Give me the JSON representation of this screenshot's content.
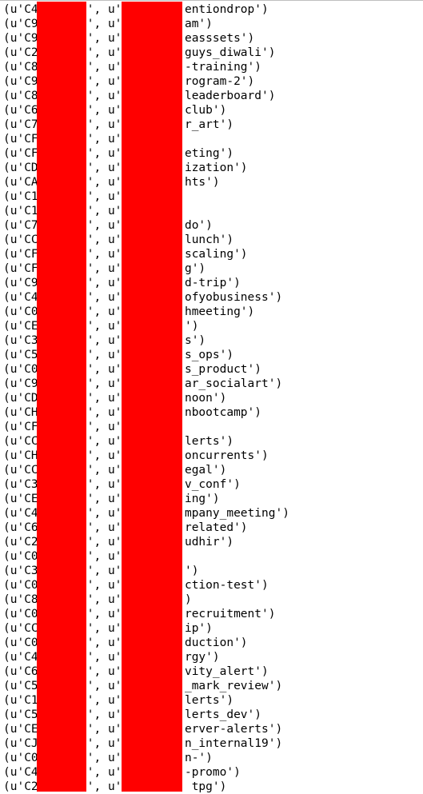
{
  "lines": [
    {
      "prefix": "(u'C4",
      "mid": "', u'",
      "suffix": "entiondrop')"
    },
    {
      "prefix": "(u'C9",
      "mid": "', u'",
      "suffix": "am')"
    },
    {
      "prefix": "(u'C9",
      "mid": "', u'",
      "suffix": "easssets')"
    },
    {
      "prefix": "(u'C2",
      "mid": "', u'",
      "suffix": "guys_diwali')"
    },
    {
      "prefix": "(u'C8",
      "mid": "', u'",
      "suffix": "-training')"
    },
    {
      "prefix": "(u'C9",
      "mid": "', u'",
      "suffix": "rogram-2')"
    },
    {
      "prefix": "(u'C8",
      "mid": "', u'",
      "suffix": "leaderboard')"
    },
    {
      "prefix": "(u'C6",
      "mid": "', u'",
      "suffix": "club')"
    },
    {
      "prefix": "(u'C7",
      "mid": "', u'",
      "suffix": "r_art')"
    },
    {
      "prefix": "(u'CF",
      "mid": "', u'",
      "suffix": ""
    },
    {
      "prefix": "(u'CF",
      "mid": "', u'",
      "suffix": "eting')"
    },
    {
      "prefix": "(u'CD",
      "mid": "', u'",
      "suffix": "ization')"
    },
    {
      "prefix": "(u'CA",
      "mid": "', u'",
      "suffix": "hts')"
    },
    {
      "prefix": "(u'C1",
      "mid": "', u'",
      "suffix": ""
    },
    {
      "prefix": "(u'C1",
      "mid": "', u'",
      "suffix": ""
    },
    {
      "prefix": "(u'C7",
      "mid": "', u'",
      "suffix": "do')"
    },
    {
      "prefix": "(u'CC",
      "mid": "', u'",
      "suffix": "lunch')"
    },
    {
      "prefix": "(u'CF",
      "mid": "', u'",
      "suffix": "scaling')"
    },
    {
      "prefix": "(u'CF",
      "mid": "', u'",
      "suffix": "g')"
    },
    {
      "prefix": "(u'C9",
      "mid": "', u'",
      "suffix": "d-trip')"
    },
    {
      "prefix": "(u'C4",
      "mid": "', u'",
      "suffix": "ofyobusiness')"
    },
    {
      "prefix": "(u'C0",
      "mid": "', u'",
      "suffix": "hmeeting')"
    },
    {
      "prefix": "(u'CE",
      "mid": "', u'",
      "suffix": "')"
    },
    {
      "prefix": "(u'C3",
      "mid": "', u'",
      "suffix": "s')"
    },
    {
      "prefix": "(u'C5",
      "mid": "', u'",
      "suffix": "s_ops')"
    },
    {
      "prefix": "(u'C0",
      "mid": "', u'",
      "suffix": "s_product')"
    },
    {
      "prefix": "(u'C9",
      "mid": "', u'",
      "suffix": "ar_socialart')"
    },
    {
      "prefix": "(u'CD",
      "mid": "', u'",
      "suffix": "noon')"
    },
    {
      "prefix": "(u'CH",
      "mid": "', u'",
      "suffix": "nbootcamp')"
    },
    {
      "prefix": "(u'CF",
      "mid": "', u'",
      "suffix": ""
    },
    {
      "prefix": "(u'CC",
      "mid": "', u'",
      "suffix": "lerts')"
    },
    {
      "prefix": "(u'CH",
      "mid": "', u'",
      "suffix": "oncurrents')"
    },
    {
      "prefix": "(u'CC",
      "mid": "', u'",
      "suffix": "egal')"
    },
    {
      "prefix": "(u'C3",
      "mid": "', u'",
      "suffix": "v_conf')"
    },
    {
      "prefix": "(u'CE",
      "mid": "', u'",
      "suffix": "ing')"
    },
    {
      "prefix": "(u'C4",
      "mid": "', u'",
      "suffix": "mpany_meeting')"
    },
    {
      "prefix": "(u'C6",
      "mid": "', u'",
      "suffix": "related')"
    },
    {
      "prefix": "(u'C2",
      "mid": "', u'",
      "suffix": "udhir')"
    },
    {
      "prefix": "(u'C0",
      "mid": "', u'",
      "suffix": ""
    },
    {
      "prefix": "(u'C3",
      "mid": "', u'",
      "suffix": "')"
    },
    {
      "prefix": "(u'C0",
      "mid": "', u'",
      "suffix": "ction-test')"
    },
    {
      "prefix": "(u'C8",
      "mid": "', u'",
      "suffix": ")"
    },
    {
      "prefix": "(u'C0",
      "mid": "', u'",
      "suffix": "recruitment')"
    },
    {
      "prefix": "(u'CC",
      "mid": "', u'",
      "suffix": "ip')"
    },
    {
      "prefix": "(u'C0",
      "mid": "', u'",
      "suffix": "duction')"
    },
    {
      "prefix": "(u'C4",
      "mid": "', u'",
      "suffix": "rgy')"
    },
    {
      "prefix": "(u'C6",
      "mid": "', u'",
      "suffix": "vity_alert')"
    },
    {
      "prefix": "(u'C5",
      "mid": "', u'",
      "suffix": "_mark_review')"
    },
    {
      "prefix": "(u'C1",
      "mid": "', u'",
      "suffix": "lerts')"
    },
    {
      "prefix": "(u'C5",
      "mid": "', u'",
      "suffix": "lerts_dev')"
    },
    {
      "prefix": "(u'CE",
      "mid": "', u'",
      "suffix": "erver-alerts')"
    },
    {
      "prefix": "(u'CJ",
      "mid": "', u'",
      "suffix": "n_internal19')"
    },
    {
      "prefix": "(u'C0",
      "mid": "', u'",
      "suffix": "n-')"
    },
    {
      "prefix": "(u'C4",
      "mid": "', u'",
      "suffix": "-promo')"
    },
    {
      "prefix": "(u'C2",
      "mid": "', u'",
      "suffix": " tpg')"
    }
  ],
  "redaction_color": "#ff0000"
}
